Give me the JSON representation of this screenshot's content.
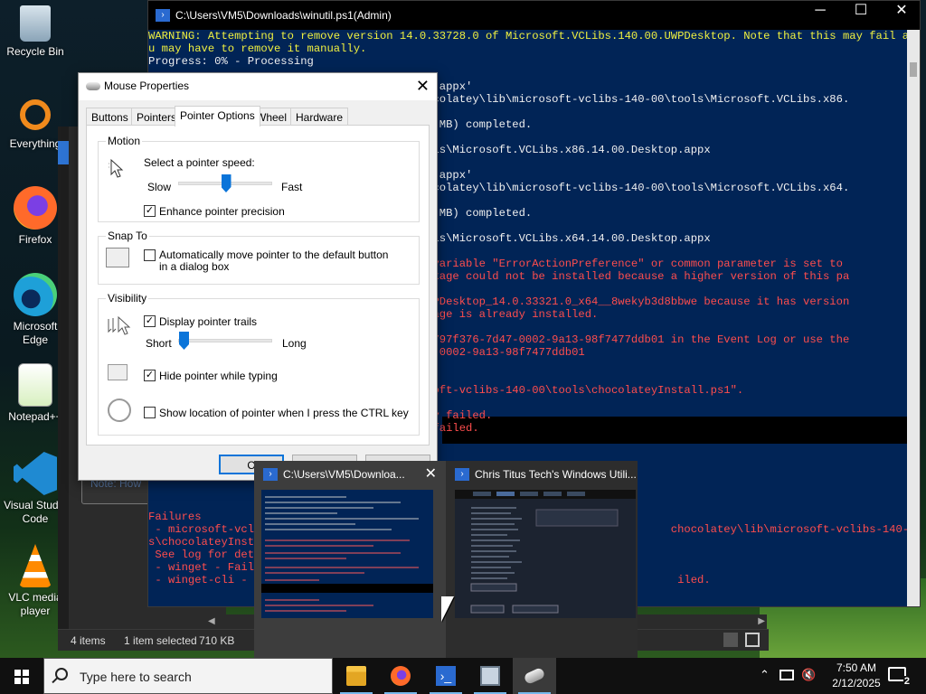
{
  "desktop": {
    "icons": [
      {
        "label": "Recycle Bin",
        "icon": "recycle-bin-icon"
      },
      {
        "label": "Everything",
        "icon": "everything-search-icon"
      },
      {
        "label": "Firefox",
        "icon": "firefox-icon"
      },
      {
        "label": "Microsoft Edge",
        "icon": "edge-icon"
      },
      {
        "label": "Notepad++",
        "icon": "notepadpp-icon"
      },
      {
        "label": "Visual Studio Code",
        "icon": "vscode-icon"
      },
      {
        "label": "VLC media player",
        "icon": "vlc-icon"
      }
    ]
  },
  "explorer": {
    "item_count": "4 items",
    "selection": "1 item selected",
    "size": "710 KB"
  },
  "powershell": {
    "title": "C:\\Users\\VM5\\Downloads\\winutil.ps1(Admin)",
    "lines": [
      {
        "text": "WARNING: Attempting to remove version 14.0.33728.0 of Microsoft.VCLibs.140.00.UWPDesktop. Note that this may fail and yo",
        "color": "yellow"
      },
      {
        "text": "u may have to remove it manually.",
        "color": "yellow"
      },
      {
        "text": "Progress: 0% - Processing                                                                                              D",
        "color": "white"
      },
      {
        "text": "",
        "color": "white"
      },
      {
        "text": "                                .00.Desktop.appx'",
        "color": "white"
      },
      {
        "text": "                                ramData\\chocolatey\\lib\\microsoft-vclibs-140-00\\tools\\Microsoft.VCLibs.x86.",
        "color": "white"
      },
      {
        "text": "",
        "color": "white"
      },
      {
        "text": "                                .appx (5.79 MB) completed.",
        "color": "white"
      },
      {
        "text": "",
        "color": "white"
      },
      {
        "text": "                                -140-00\\tools\\Microsoft.VCLibs.x86.14.00.Desktop.appx",
        "color": "white"
      },
      {
        "text": "                                                                                                                      D",
        "color": "white"
      },
      {
        "text": "                                .00.Desktop.appx'",
        "color": "white"
      },
      {
        "text": "                                ramData\\chocolatey\\lib\\microsoft-vclibs-140-00\\tools\\Microsoft.VCLibs.x64.",
        "color": "white"
      },
      {
        "text": "",
        "color": "white"
      },
      {
        "text": "                                .appx (6.45 MB) completed.",
        "color": "white"
      },
      {
        "text": "",
        "color": "white"
      },
      {
        "text": "                                -140-00\\tools\\Microsoft.VCLibs.x64.14.00.Desktop.appx",
        "color": "white"
      },
      {
        "text": "                                                                                                                      E",
        "color": "red"
      },
      {
        "text": "                                preference variable \"ErrorActionPreference\" or common parameter is set to",
        "color": "red"
      },
      {
        "text": "                                05, The package could not be installed because a higher version of this pa",
        "color": "red"
      },
      {
        "text": "",
        "color": "white"
      },
      {
        "text": "                                y.140.00.UWPDesktop_14.0.33321.0_x64__8wekyb3d8bbwe because it has version",
        "color": "red"
      },
      {
        "text": "                                f this package is already installed.",
        "color": "red"
      },
      {
        "text": "",
        "color": "white"
      },
      {
        "text": "                                tivityId] f797f376-7d47-0002-9a13-98f7477ddb01 in the Event Log or use the",
        "color": "red"
      },
      {
        "text": "                                97f376-7d47-0002-9a13-98f7477ddb01",
        "color": "red"
      },
      {
        "text": "",
        "color": "white"
      },
      {
        "text": "                                 successful.",
        "color": "red"
      },
      {
        "text": "                                \\lib\\microsoft-vclibs-140-00\\tools\\chocolateyInstall.ps1\".",
        "color": "red"
      },
      {
        "text": "",
        "color": "white"
      },
      {
        "text": "                                a dependancy failed.",
        "color": "red"
      },
      {
        "text": "                                dependancy failed.",
        "color": "red"
      }
    ],
    "lower_lines": [
      {
        "text": "                See the log for",
        "color": "white"
      },
      {
        "text": "",
        "color": "white"
      },
      {
        "text": "Failures",
        "color": "red"
      },
      {
        "text": " - microsoft-vcli                                                              chocolatey\\lib\\microsoft-vclibs-140-00\\tool",
        "color": "red"
      },
      {
        "text": "s\\chocolateyInsta",
        "color": "red"
      },
      {
        "text": " See log for deta",
        "color": "red"
      },
      {
        "text": " - winget - Faile",
        "color": "red"
      },
      {
        "text": " - winget-cli - F                                                               iled.",
        "color": "red"
      }
    ]
  },
  "mouse_properties": {
    "title": "Mouse Properties",
    "tabs": [
      "Buttons",
      "Pointers",
      "Pointer Options",
      "Wheel",
      "Hardware"
    ],
    "active_tab": "Pointer Options",
    "motion": {
      "caption": "Motion",
      "speed_label": "Select a pointer speed:",
      "slow": "Slow",
      "fast": "Fast",
      "speed_value": 0.5,
      "precision_label": "Enhance pointer precision",
      "precision_checked": true
    },
    "snap_to": {
      "caption": "Snap To",
      "label": "Automatically move pointer to the default button in a dialog box",
      "checked": false
    },
    "visibility": {
      "caption": "Visibility",
      "trails_label": "Display pointer trails",
      "trails_checked": true,
      "short": "Short",
      "long": "Long",
      "trail_value": 0.0,
      "hide_label": "Hide pointer while typing",
      "hide_checked": true,
      "ctrl_label": "Show location of pointer when I press the CTRL key",
      "ctrl_checked": false
    },
    "buttons": {
      "ok": "O"
    }
  },
  "behind_text": "Note: How",
  "thumbnails": [
    {
      "title": "C:\\Users\\VM5\\Downloa...",
      "close": "✕"
    },
    {
      "title": "Chris Titus Tech's Windows Utili...",
      "close": ""
    }
  ],
  "taskbar": {
    "search_placeholder": "Type here to search",
    "apps": [
      "file-explorer-icon",
      "firefox-icon",
      "powershell-icon",
      "remote-desktop-icon",
      "mouse-icon"
    ],
    "time": "7:50 AM",
    "date": "2/12/2025",
    "notification_count": "2"
  },
  "colors": {
    "console_bg": "#012456",
    "console_warning": "#f0f040",
    "console_error": "#ff4d4d",
    "accent": "#0a74d9"
  }
}
